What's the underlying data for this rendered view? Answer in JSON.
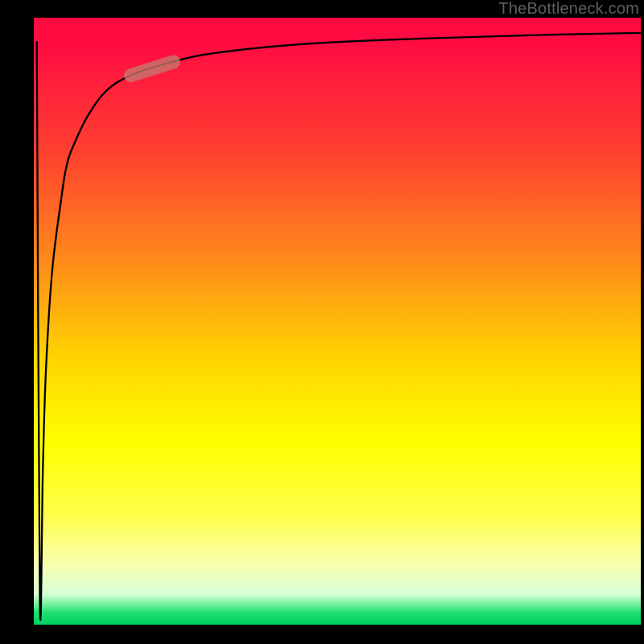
{
  "watermark": "TheBottleneck.com",
  "colors": {
    "gradient_top": "#ff0b42",
    "gradient_mid1": "#ff8a1a",
    "gradient_mid2": "#ffff00",
    "gradient_bottom": "#00d060",
    "curve": "#000000",
    "highlight": "rgba(200,120,110,0.78)",
    "background": "#000000"
  },
  "chart_data": {
    "type": "line",
    "title": "",
    "xlabel": "",
    "ylabel": "",
    "xlim": [
      0,
      100
    ],
    "ylim": [
      0,
      100
    ],
    "series": [
      {
        "name": "bottleneck-curve",
        "x": [
          0.5,
          1.0,
          1.5,
          2.0,
          3.0,
          4.5,
          5.5,
          7.0,
          9.0,
          12.0,
          16.0,
          22.0,
          30.0,
          45.0,
          65.0,
          85.0,
          100.0
        ],
        "y": [
          96.0,
          4.0,
          26.0,
          42.0,
          58.0,
          70.0,
          76.0,
          80.0,
          84.0,
          88.0,
          90.5,
          92.5,
          94.2,
          95.7,
          96.6,
          97.2,
          97.5
        ]
      }
    ],
    "highlight_segment": {
      "series": "bottleneck-curve",
      "x_start": 16.0,
      "x_end": 23.0
    },
    "annotations": [
      {
        "text": "TheBottleneck.com",
        "position": "top-right"
      }
    ]
  }
}
